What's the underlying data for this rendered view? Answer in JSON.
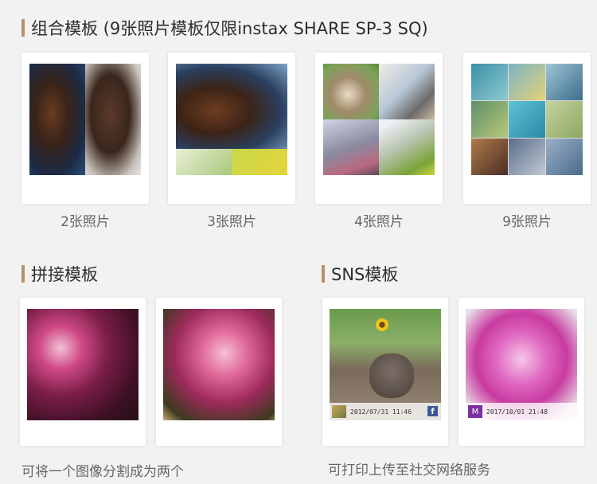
{
  "sections": {
    "combo": {
      "title": "组合模板 (9张照片模板仅限instax SHARE SP-3 SQ)"
    },
    "collage": {
      "title": "拼接模板",
      "description": "可将一个图像分割成为两个"
    },
    "sns": {
      "title": "SNS模板",
      "description": "可打印上传至社交网络服务"
    }
  },
  "combo_templates": [
    {
      "label": "2张照片"
    },
    {
      "label": "3张照片"
    },
    {
      "label": "4张照片"
    },
    {
      "label": "9张照片"
    }
  ],
  "sns_templates": [
    {
      "timestamp": "2012/07/31 11:46",
      "badge": "f"
    },
    {
      "timestamp": "2017/10/01 21:48",
      "badge": "M"
    }
  ],
  "colors": {
    "accent_bar": "#b4916c",
    "background": "#f2f2f2",
    "card": "#ffffff",
    "facebook": "#3b5998",
    "badge_purple": "#7b2fa0"
  }
}
